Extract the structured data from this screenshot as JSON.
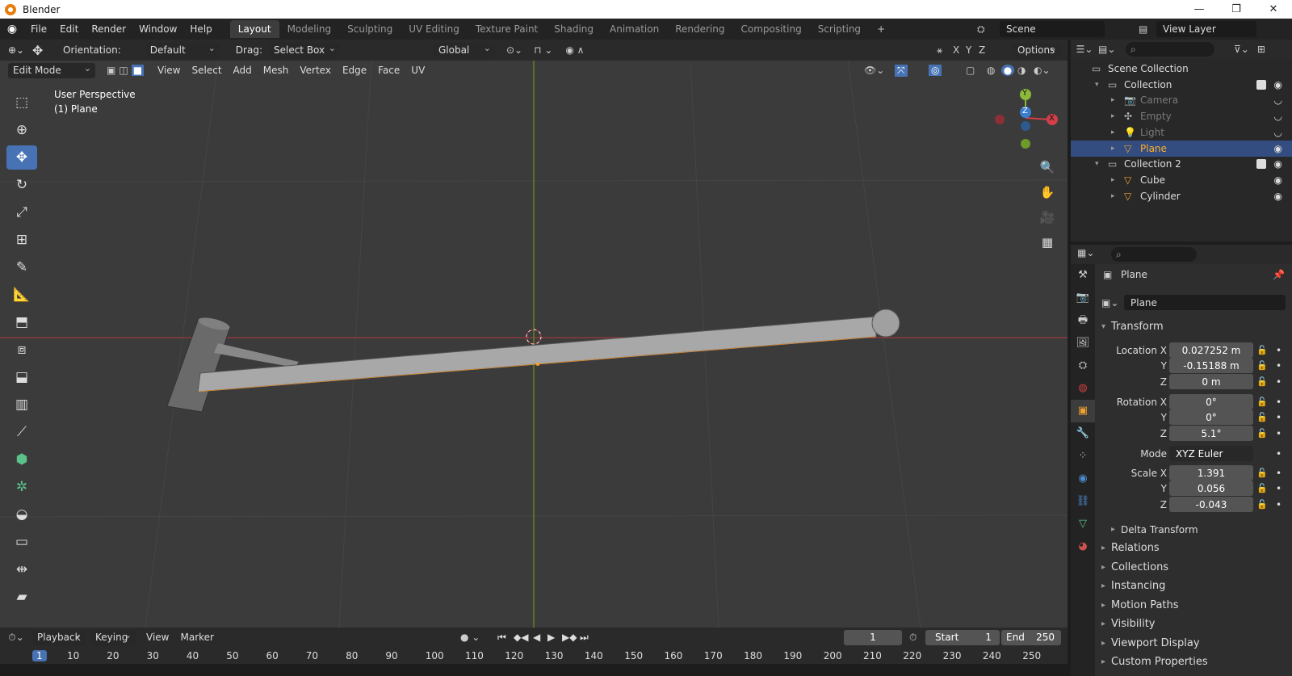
{
  "window": {
    "title": "Blender",
    "controls": [
      "—",
      "❐",
      "✕"
    ]
  },
  "menu": [
    "File",
    "Edit",
    "Render",
    "Window",
    "Help"
  ],
  "workspaces": [
    "Layout",
    "Modeling",
    "Sculpting",
    "UV Editing",
    "Texture Paint",
    "Shading",
    "Animation",
    "Rendering",
    "Compositing",
    "Scripting"
  ],
  "active_workspace": "Layout",
  "scene": "Scene",
  "view_layer": "View Layer",
  "header": {
    "orientation_label": "Orientation:",
    "orientation": "Default",
    "drag_label": "Drag:",
    "drag": "Select Box",
    "transform": "Global",
    "options": "Options",
    "axes": [
      "X",
      "Y",
      "Z"
    ]
  },
  "header2": {
    "mode": "Edit Mode",
    "menus": [
      "View",
      "Select",
      "Add",
      "Mesh",
      "Vertex",
      "Edge",
      "Face",
      "UV"
    ]
  },
  "viewport": {
    "perspective": "User Perspective",
    "object": "(1) Plane"
  },
  "gizmo": {
    "y": "Y",
    "x": "X",
    "z": "Z"
  },
  "timeline": {
    "menus": [
      "Playback",
      "Keying",
      "View",
      "Marker"
    ],
    "frame": "1",
    "start_label": "Start",
    "start": "1",
    "end_label": "End",
    "end": "250"
  },
  "ruler": [
    "10",
    "20",
    "30",
    "40",
    "50",
    "60",
    "70",
    "80",
    "90",
    "100",
    "110",
    "120",
    "130",
    "140",
    "150",
    "160",
    "170",
    "180",
    "190",
    "200",
    "210",
    "220",
    "230",
    "240",
    "250"
  ],
  "ruler_current": "1",
  "outliner": [
    {
      "name": "Scene Collection",
      "indent": 0,
      "icon": "▭"
    },
    {
      "name": "Collection",
      "indent": 1,
      "icon": "▭",
      "check": true
    },
    {
      "name": "Camera",
      "indent": 2,
      "icon": "📷",
      "dim": true
    },
    {
      "name": "Empty",
      "indent": 2,
      "icon": "✣",
      "dim": true
    },
    {
      "name": "Light",
      "indent": 2,
      "icon": "💡",
      "dim": true
    },
    {
      "name": "Plane",
      "indent": 2,
      "icon": "▽",
      "sel": true
    },
    {
      "name": "Collection 2",
      "indent": 1,
      "icon": "▭",
      "check": true
    },
    {
      "name": "Cube",
      "indent": 2,
      "icon": "▽"
    },
    {
      "name": "Cylinder",
      "indent": 2,
      "icon": "▽"
    }
  ],
  "props": {
    "object": "Plane",
    "name": "Plane",
    "transform": "Transform",
    "location": {
      "label": "Location X",
      "x": "0.027252 m",
      "y": "-0.15188 m",
      "z": "0 m"
    },
    "rotation": {
      "label": "Rotation X",
      "x": "0°",
      "y": "0°",
      "z": "5.1°"
    },
    "mode_label": "Mode",
    "mode": "XYZ Euler",
    "scale": {
      "label": "Scale X",
      "x": "1.391",
      "y": "0.056",
      "z": "-0.043"
    },
    "y_label": "Y",
    "z_label": "Z",
    "delta": "Delta Transform",
    "panels": [
      "Relations",
      "Collections",
      "Instancing",
      "Motion Paths",
      "Visibility",
      "Viewport Display",
      "Custom Properties"
    ]
  }
}
